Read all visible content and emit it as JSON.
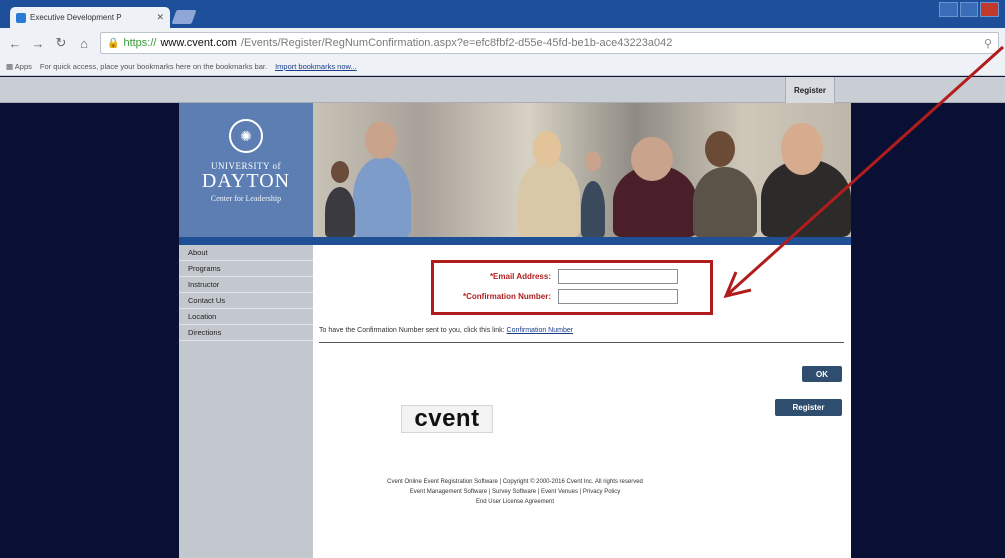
{
  "browser": {
    "tab_title": "Executive Development P",
    "tab_close": "✕",
    "url_https": "https://",
    "url_domain": "www.cvent.com",
    "url_path": "/Events/Register/RegNumConfirmation.aspx?e=efc8fbf2-d55e-45fd-be1b-ace43223a042",
    "bookmarks_apps": "Apps",
    "bookmarks_hint": "For quick access, place your bookmarks here on the bookmarks bar.",
    "bookmarks_import": "Import bookmarks now..."
  },
  "page": {
    "register_link": "Register",
    "logo": {
      "university": "UNIVERSITY of",
      "name": "DAYTON",
      "subtitle": "Center for Leadership"
    },
    "sidebar_items": [
      "About",
      "Programs",
      "Instructor",
      "Contact Us",
      "Location",
      "Directions"
    ],
    "form": {
      "email_label": "*Email Address:",
      "confirmation_label": "*Confirmation Number:",
      "email_value": "",
      "confirmation_value": ""
    },
    "info_text": "To have the Confirmation Number sent to you, click this link:",
    "info_link": "Confirmation Number",
    "ok_button": "OK",
    "register_button": "Register",
    "cvent_logo": "cvent",
    "footer_line1": "Cvent Online Event Registration Software | Copyright © 2000-2016 Cvent Inc. All rights reserved",
    "footer_line2": "Event Management Software | Survey Software | Event Venues | Privacy Policy",
    "footer_line3": "End User License Agreement"
  },
  "colors": {
    "highlight": "#b11d1d",
    "brand_blue": "#2a5ea6",
    "button": "#2f4d6e"
  }
}
